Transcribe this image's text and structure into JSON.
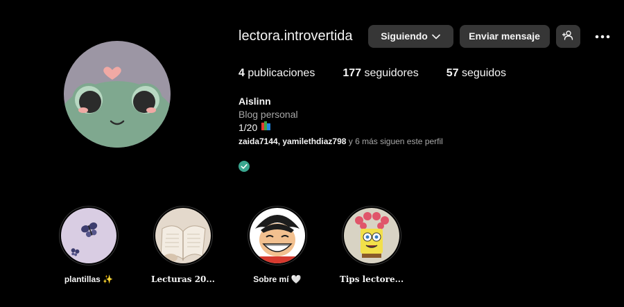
{
  "profile": {
    "username": "lectora.introvertida",
    "avatar_icon": "frog-avatar-icon"
  },
  "actions": {
    "following_label": "Siguiendo",
    "message_label": "Enviar mensaje",
    "add_user_icon": "add-user-icon",
    "more_icon": "more-options-icon"
  },
  "stats": {
    "posts_count": "4",
    "posts_label": "publicaciones",
    "followers_count": "177",
    "followers_label": "seguidores",
    "following_count": "57",
    "following_label": "seguidos"
  },
  "bio": {
    "name": "Aislinn",
    "category": "Blog personal",
    "line": "1/20",
    "line_icon": "books-emoji-icon",
    "followed_by_users": "zaida7144, yamilethdiaz798",
    "followed_by_rest": " y 6 más siguen este perfil",
    "badge_icon": "check-circle-icon"
  },
  "highlights": [
    {
      "label": "plantillas ✨"
    },
    {
      "label": "Lecturas 20..."
    },
    {
      "label": "Sobre mí 🤍"
    },
    {
      "label": "Tips lectore..."
    }
  ],
  "colors": {
    "background": "#000000",
    "button": "#363636",
    "muted_text": "#a8a8a8",
    "badge_teal": "#3aa68f"
  }
}
